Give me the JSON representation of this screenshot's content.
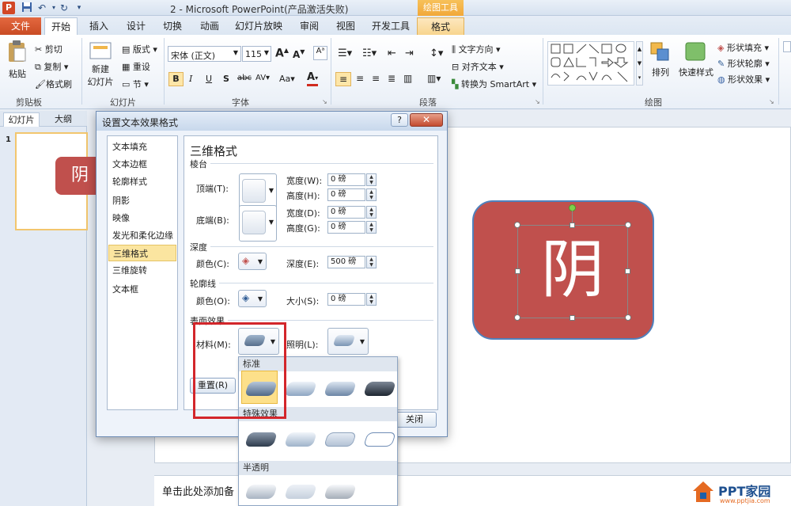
{
  "window": {
    "title": "2 - Microsoft PowerPoint(产品激活失败)",
    "context_tab_label": "绘图工具"
  },
  "qat": {
    "save_icon": "save-icon",
    "undo_icon": "undo-icon",
    "redo_icon": "redo-icon"
  },
  "tabs": [
    {
      "label": "文件"
    },
    {
      "label": "开始"
    },
    {
      "label": "插入"
    },
    {
      "label": "设计"
    },
    {
      "label": "切换"
    },
    {
      "label": "动画"
    },
    {
      "label": "幻灯片放映"
    },
    {
      "label": "审阅"
    },
    {
      "label": "视图"
    },
    {
      "label": "开发工具"
    },
    {
      "label": "格式"
    }
  ],
  "ribbon": {
    "clipboard": {
      "paste": "粘贴",
      "cut": "剪切",
      "copy": "复制",
      "painter": "格式刷",
      "label": "剪贴板"
    },
    "slides": {
      "new": "新建",
      "new2": "幻灯片",
      "layout": "版式",
      "reset": "重设",
      "section": "节",
      "label": "幻灯片"
    },
    "font": {
      "name": "宋体 (正文)",
      "size": "115",
      "label": "字体",
      "bold": "B",
      "italic": "I",
      "underline": "U",
      "shadow": "S",
      "strike": "abc",
      "spacing": "AV",
      "case": "Aa",
      "color": "A",
      "grow": "A",
      "shrink": "A"
    },
    "paragraph": {
      "text_direction": "文字方向",
      "align_text": "对齐文本",
      "smartart": "转换为 SmartArt",
      "label": "段落"
    },
    "drawing": {
      "arrange": "排列",
      "quick_styles": "快速样式",
      "fill": "形状填充",
      "outline": "形状轮廓",
      "effects": "形状效果",
      "label": "绘图"
    }
  },
  "left_panel": {
    "tab_slides": "幻灯片",
    "tab_outline": "大纲",
    "slide_number": "1",
    "thumb_text": "阴"
  },
  "slide": {
    "shape_text": "阴",
    "notes_placeholder": "单击此处添加备"
  },
  "dialog": {
    "title": "设置文本效果格式",
    "help": "?",
    "close": "✕",
    "nav": [
      "文本填充",
      "文本边框",
      "轮廓样式",
      "阴影",
      "映像",
      "发光和柔化边缘",
      "三维格式",
      "三维旋转",
      "文本框"
    ],
    "selected_nav": "三维格式",
    "heading": "三维格式",
    "bevel": {
      "section": "棱台",
      "top_label": "顶端(T):",
      "bottom_label": "底端(B):",
      "top_width_label": "宽度(W):",
      "top_width": "0 磅",
      "top_height_label": "高度(H):",
      "top_height": "0 磅",
      "bottom_width_label": "宽度(D):",
      "bottom_width": "0 磅",
      "bottom_height_label": "高度(G):",
      "bottom_height": "0 磅"
    },
    "depth": {
      "section": "深度",
      "color_label": "颜色(C):",
      "depth_label": "深度(E):",
      "depth_value": "500 磅"
    },
    "contour": {
      "section": "轮廓线",
      "color_label": "颜色(O):",
      "size_label": "大小(S):",
      "size_value": "0 磅"
    },
    "surface": {
      "section": "表面效果",
      "material_label": "材料(M):",
      "lighting_label": "照明(L):"
    },
    "reset_button": "重置(R)",
    "close_button": "关闭"
  },
  "material_menu": {
    "standard_header": "标准",
    "special_header": "特殊效果",
    "translucent_header": "半透明",
    "standard": [
      "matte",
      "warm-matte",
      "plastic",
      "metal"
    ],
    "special": [
      "dark-edge",
      "soft-edge",
      "flat",
      "wire-frame"
    ],
    "translucent": [
      "powder",
      "clear",
      "soft-metal"
    ]
  },
  "watermark": {
    "brand": "PPT家园",
    "url": "www.pptjia.com"
  },
  "colors": {
    "shape_fill": "#c0504d",
    "file_tab": "#d24726",
    "highlight_border": "#d3262b"
  }
}
